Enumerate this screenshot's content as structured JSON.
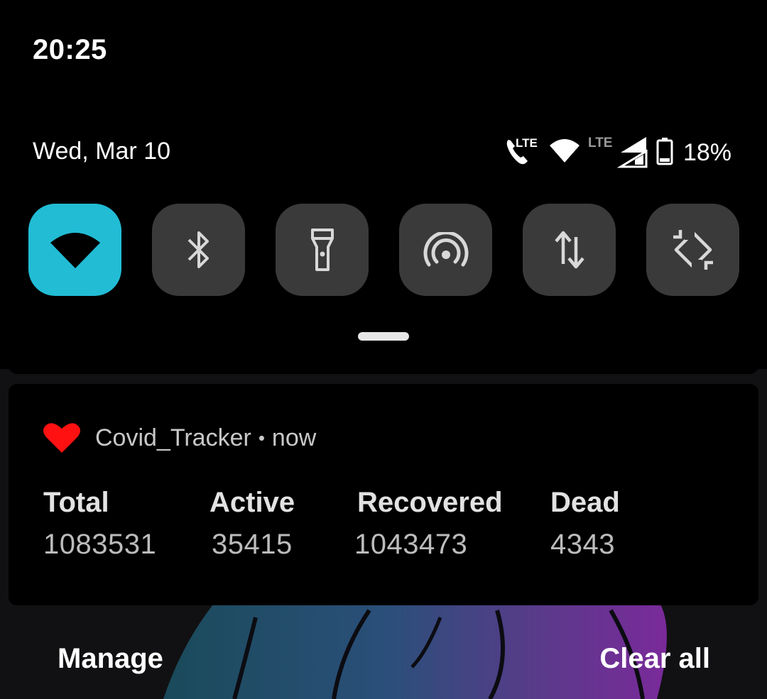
{
  "status_bar": {
    "time": "20:25"
  },
  "quick_settings": {
    "date": "Wed, Mar 10",
    "battery_percent": "18%",
    "call_network_label": "LTE",
    "data_network_label": "LTE",
    "tiles": [
      {
        "name": "wifi",
        "icon": "wifi-icon",
        "active": true
      },
      {
        "name": "bluetooth",
        "icon": "bluetooth-icon",
        "active": false
      },
      {
        "name": "flashlight",
        "icon": "flashlight-icon",
        "active": false
      },
      {
        "name": "hotspot",
        "icon": "hotspot-icon",
        "active": false
      },
      {
        "name": "mobile-data",
        "icon": "data-transfer-icon",
        "active": false
      },
      {
        "name": "auto-rotate",
        "icon": "auto-rotate-icon",
        "active": false
      }
    ],
    "active_tile_color": "#22bcd5",
    "inactive_tile_color": "#3a3a3a"
  },
  "notification": {
    "app_icon": "heart-icon",
    "app_name": "Covid_Tracker",
    "separator": "•",
    "time": "now",
    "stats": [
      {
        "label": "Total",
        "value": "1083531"
      },
      {
        "label": "Active",
        "value": "35415"
      },
      {
        "label": "Recovered",
        "value": "1043473"
      },
      {
        "label": "Dead",
        "value": "4343"
      }
    ],
    "icon_color": "#ff0000"
  },
  "actions": {
    "manage": "Manage",
    "clear_all": "Clear all"
  }
}
